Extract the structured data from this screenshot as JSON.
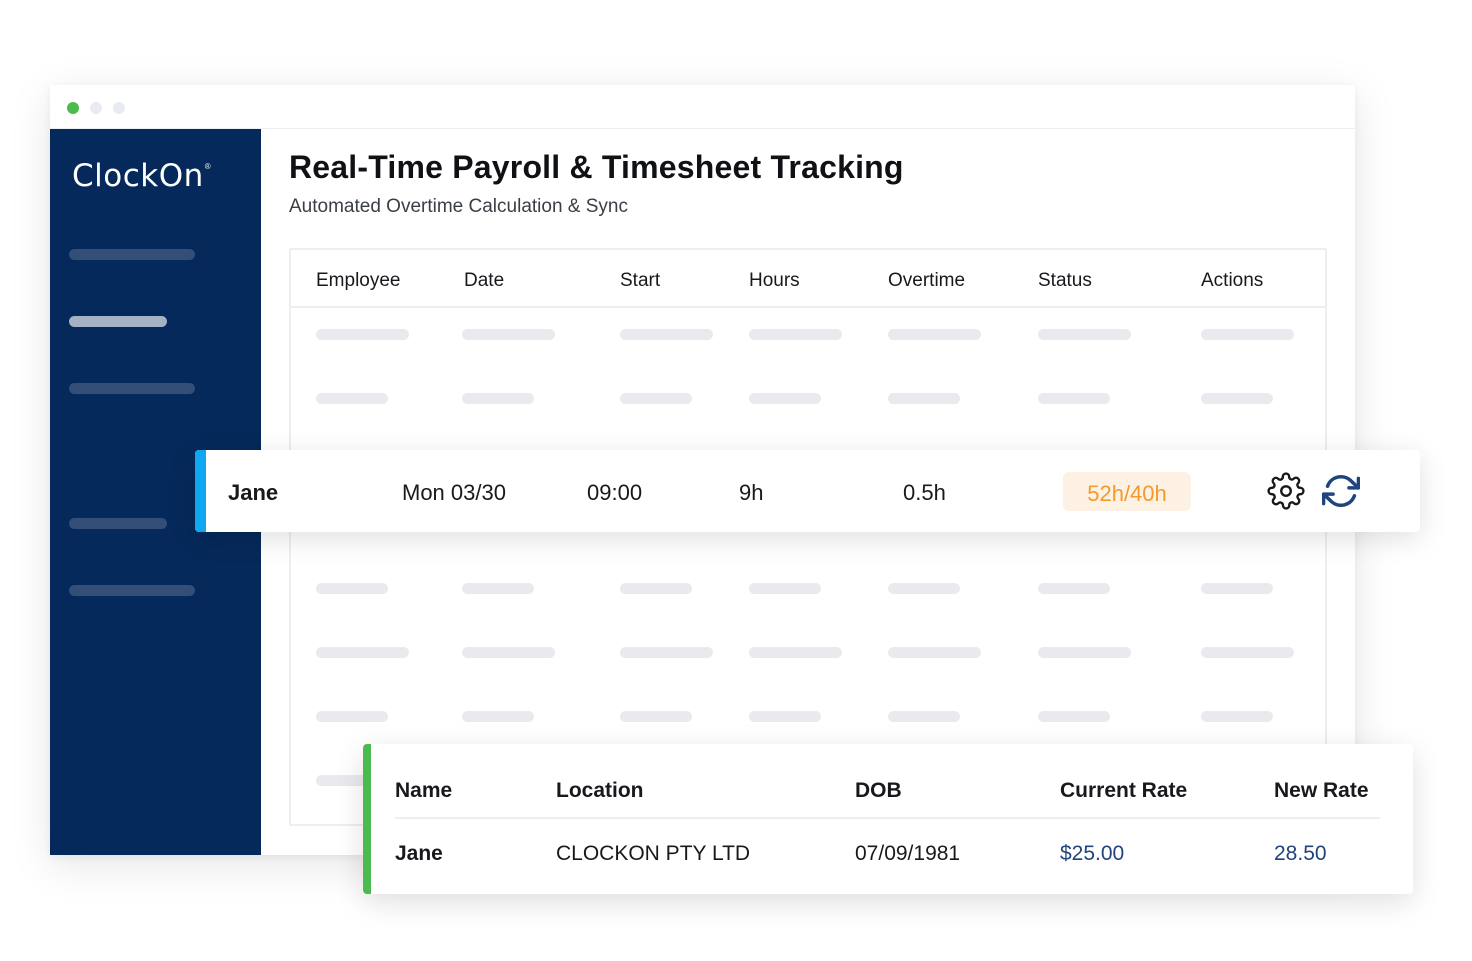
{
  "window": {
    "controls": [
      "close-dot",
      "minimize-dot",
      "maximize-dot"
    ]
  },
  "brand": {
    "logo_text": "ClockOn",
    "logo_mark": "®"
  },
  "page": {
    "title": "Real-Time Payroll & Timesheet Tracking",
    "subtitle": "Automated Overtime Calculation & Sync"
  },
  "timesheet_table": {
    "headers": [
      "Employee",
      "Date",
      "Start",
      "Hours",
      "Overtime",
      "Status",
      "Actions"
    ]
  },
  "highlighted_row": {
    "employee": "Jane",
    "date": "Mon 03/30",
    "start": "09:00",
    "hours": "9h",
    "overtime": "0.5h",
    "status": "52h/40h",
    "actions": [
      "gear-icon",
      "sync-icon"
    ]
  },
  "employee_card": {
    "headers": [
      "Name",
      "Location",
      "DOB",
      "Current Rate",
      "New Rate"
    ],
    "row": {
      "name": "Jane",
      "location": "CLOCKON PTY LTD",
      "dob": "07/09/1981",
      "current_rate": "$25.00",
      "new_rate": "28.50"
    }
  },
  "colors": {
    "sidebar": "#05295a",
    "row_accent": "#0fa7f0",
    "card_accent": "#4cbb4e",
    "status_text": "#f29a2e",
    "status_bg": "#fdf1e3",
    "money_text": "#20447d"
  }
}
